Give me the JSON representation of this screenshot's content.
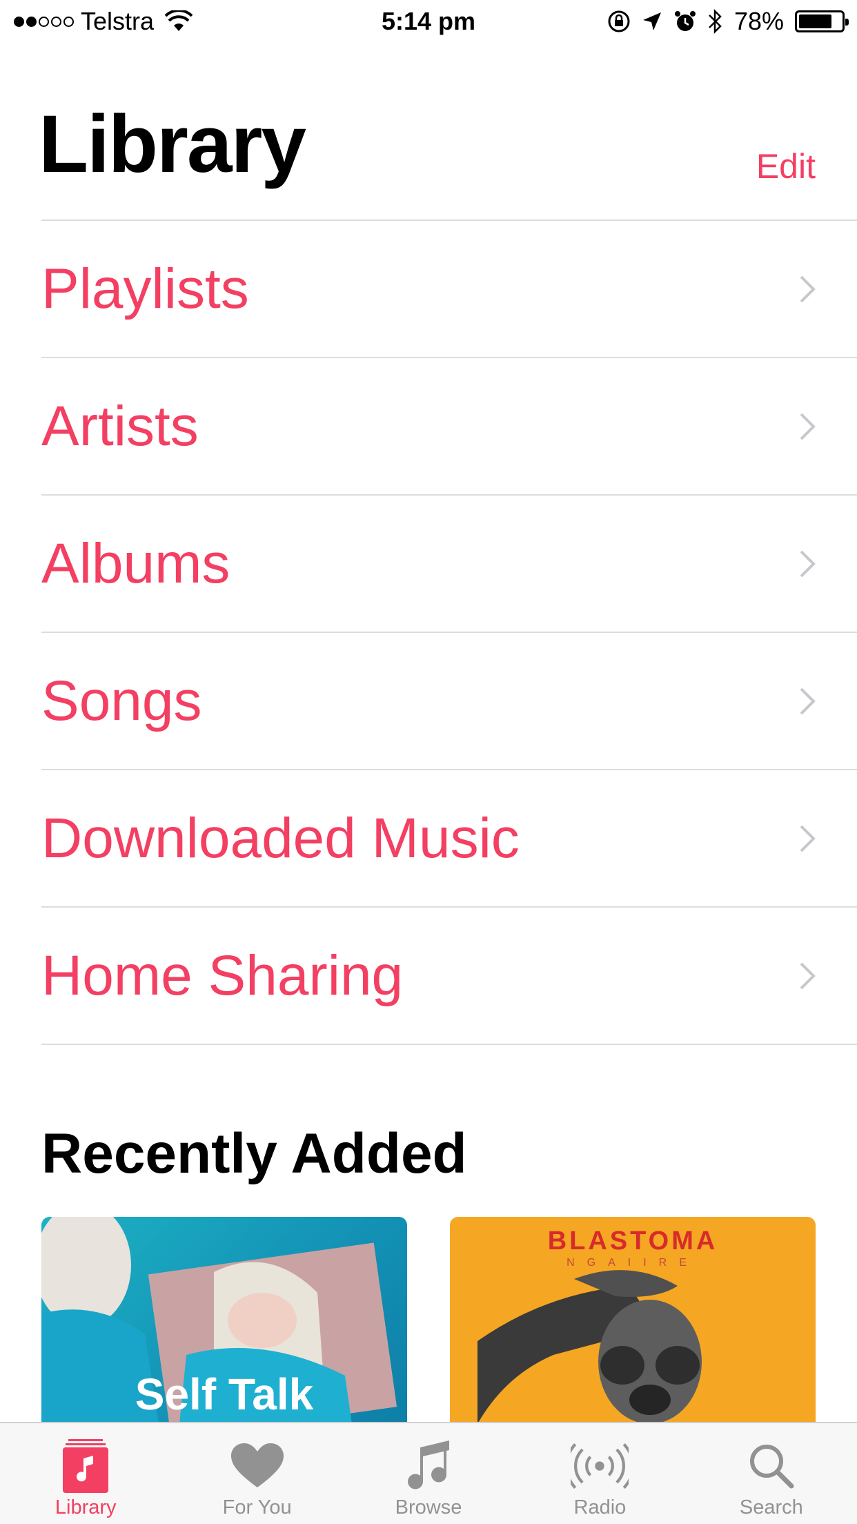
{
  "status_bar": {
    "carrier": "Telstra",
    "time": "5:14 pm",
    "battery_percent": "78%",
    "battery_level": 0.78,
    "signal_bars": 2,
    "icons": [
      "wifi-icon",
      "orientation-lock-icon",
      "location-icon",
      "alarm-icon",
      "bluetooth-icon",
      "battery-icon"
    ]
  },
  "header": {
    "title": "Library",
    "edit_label": "Edit"
  },
  "library_items": [
    {
      "label": "Playlists"
    },
    {
      "label": "Artists"
    },
    {
      "label": "Albums"
    },
    {
      "label": "Songs"
    },
    {
      "label": "Downloaded Music"
    },
    {
      "label": "Home Sharing"
    }
  ],
  "recently_added": {
    "title": "Recently Added",
    "albums": [
      {
        "cover_text": "Self Talk"
      },
      {
        "cover_title": "BLASTOMA",
        "cover_subtitle": "NGAIIRE"
      }
    ]
  },
  "tab_bar": {
    "tabs": [
      {
        "label": "Library",
        "icon": "library-icon",
        "active": true
      },
      {
        "label": "For You",
        "icon": "heart-icon",
        "active": false
      },
      {
        "label": "Browse",
        "icon": "music-note-icon",
        "active": false
      },
      {
        "label": "Radio",
        "icon": "radio-icon",
        "active": false
      },
      {
        "label": "Search",
        "icon": "search-icon",
        "active": false
      }
    ]
  },
  "colors": {
    "accent": "#f33f62",
    "separator": "#dddddd",
    "tab_inactive": "#929292",
    "tab_bar_bg": "#f7f7f7"
  }
}
